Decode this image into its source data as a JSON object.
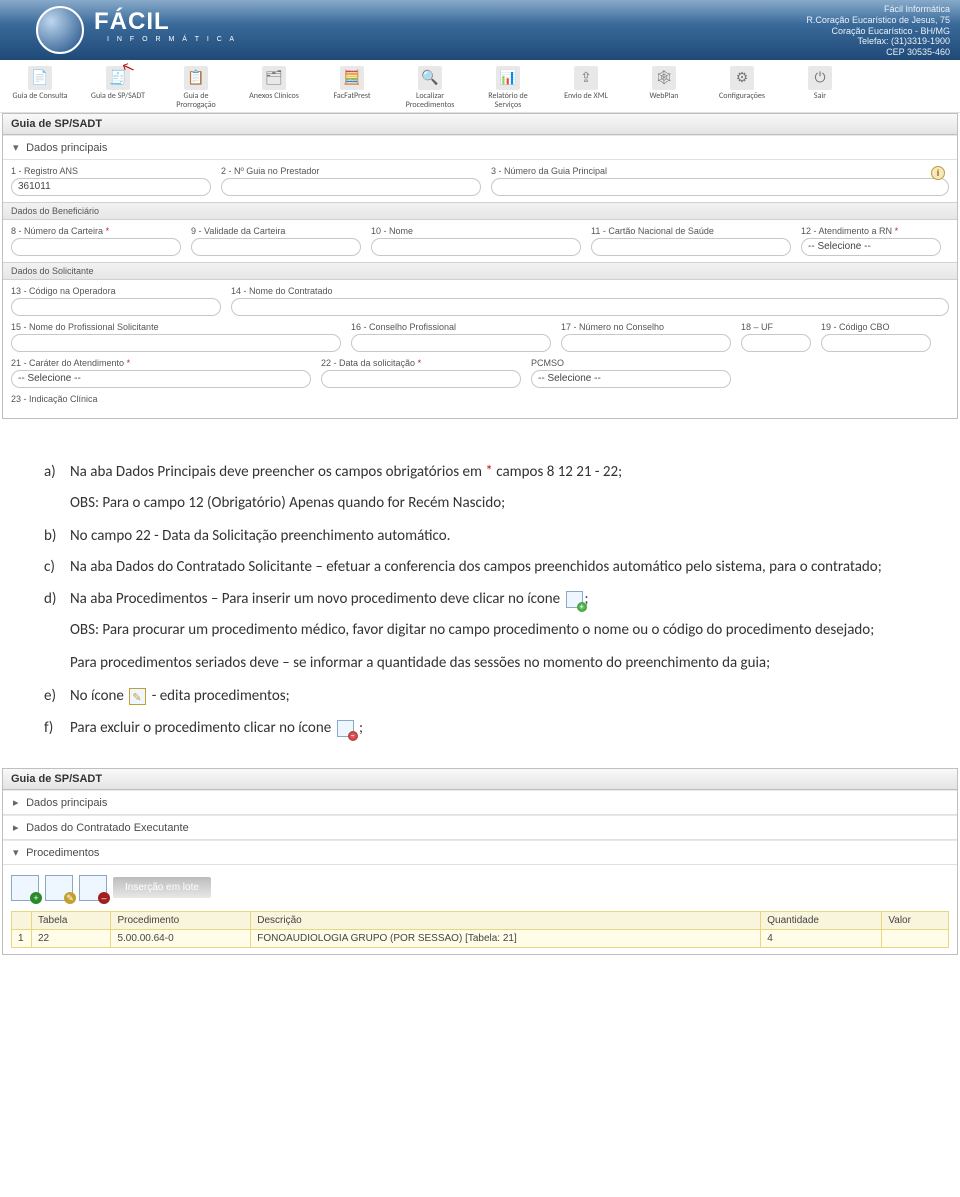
{
  "header": {
    "brand": "FÁCIL",
    "brand_sub": "I N F O R M Á T I C A",
    "info_lines": [
      "Fácil Informática",
      "R.Coração Eucarístico de Jesus, 75",
      "Coração Eucarístico - BH/MG",
      "Telefax: (31)3319-1900",
      "CEP 30535-460"
    ]
  },
  "toolbar": [
    {
      "label": "Guia de Consulta",
      "glyph": "📄"
    },
    {
      "label": "Guia de SP/SADT",
      "glyph": "🧾",
      "pointer": true
    },
    {
      "label": "Guia de Prorrogação",
      "glyph": "📋"
    },
    {
      "label": "Anexos Clínicos",
      "glyph": "🗂"
    },
    {
      "label": "FacFatPrest",
      "glyph": "🧮"
    },
    {
      "label": "Localizar Procedimentos",
      "glyph": "🔍"
    },
    {
      "label": "Relatório de Serviços",
      "glyph": "📊"
    },
    {
      "label": "Envio de XML",
      "glyph": "⇪"
    },
    {
      "label": "WebPlan",
      "glyph": "🕸"
    },
    {
      "label": "Configurações",
      "glyph": "⚙"
    },
    {
      "label": "Sair",
      "glyph": "⏻"
    }
  ],
  "win1": {
    "title": "Guia de SP/SADT",
    "acc1": "Dados principais",
    "g_benef": "Dados do Beneficiário",
    "g_solic": "Dados do Solicitante",
    "f1": {
      "label": "1 - Registro ANS",
      "value": "361011"
    },
    "f2": {
      "label": "2 - Nº Guia no Prestador",
      "value": ""
    },
    "f3": {
      "label": "3 - Número da Guia Principal",
      "value": ""
    },
    "f8": {
      "label": "8 - Número da Carteira",
      "req": "*",
      "value": ""
    },
    "f9": {
      "label": "9 - Validade da Carteira",
      "value": ""
    },
    "f10": {
      "label": "10 - Nome",
      "value": ""
    },
    "f11": {
      "label": "11 - Cartão Nacional de Saúde",
      "value": ""
    },
    "f12": {
      "label": "12 - Atendimento a RN",
      "req": "*",
      "value": "-- Selecione --"
    },
    "f13": {
      "label": "13 - Código na Operadora",
      "value": ""
    },
    "f14": {
      "label": "14 - Nome do Contratado",
      "value": ""
    },
    "f15": {
      "label": "15 - Nome do Profissional Solicitante",
      "value": ""
    },
    "f16": {
      "label": "16 - Conselho Profissional",
      "value": ""
    },
    "f17": {
      "label": "17 - Número no Conselho",
      "value": ""
    },
    "f18": {
      "label": "18 – UF",
      "value": ""
    },
    "f19": {
      "label": "19 - Código CBO",
      "value": ""
    },
    "f21": {
      "label": "21 - Caráter do Atendimento",
      "req": "*",
      "value": "-- Selecione --"
    },
    "f22": {
      "label": "22 - Data da solicitação",
      "req": "*",
      "value": ""
    },
    "fpcm": {
      "label": "PCMSO",
      "value": "-- Selecione --"
    },
    "f23": {
      "label": "23 - Indicação Clínica",
      "value": ""
    }
  },
  "doc": {
    "a": "Na aba Dados Principais deve preencher os campos obrigatórios em",
    "a_red": "*",
    "a_tail": "campos 8 12 21 - 22;",
    "obs1": "OBS: Para o campo 12 (Obrigatório) Apenas quando for Recém Nascido;",
    "b": "No campo 22 - Data da Solicitação preenchimento automático.",
    "c": "Na aba Dados do Contratado Solicitante – efetuar a conferencia dos campos preenchidos automático pelo sistema, para o contratado;",
    "d1": "Na aba Procedimentos – Para inserir um novo procedimento deve clicar no ícone",
    "d1_tail": ";",
    "d_obs": "OBS: Para procurar um procedimento médico, favor digitar no campo procedimento o nome ou o código do procedimento desejado;",
    "d_ser": "Para procedimentos seriados deve – se informar a quantidade das sessões no momento do preenchimento da guia;",
    "e1": "No ícone",
    "e2": "- edita procedimentos;",
    "f1": "Para excluir o procedimento clicar no ícone",
    "f2": ";"
  },
  "win2": {
    "title": "Guia de SP/SADT",
    "acc1": "Dados principais",
    "acc2": "Dados do Contratado Executante",
    "acc3": "Procedimentos",
    "lot_btn": "Inserção em lote",
    "cols": [
      "Tabela",
      "Procedimento",
      "Descrição",
      "Quantidade",
      "Valor"
    ],
    "row": [
      "22",
      "5.00.00.64-0",
      "FONOAUDIOLOGIA GRUPO (POR SESSAO) [Tabela: 21]",
      "4",
      ""
    ],
    "row_num": "1"
  }
}
